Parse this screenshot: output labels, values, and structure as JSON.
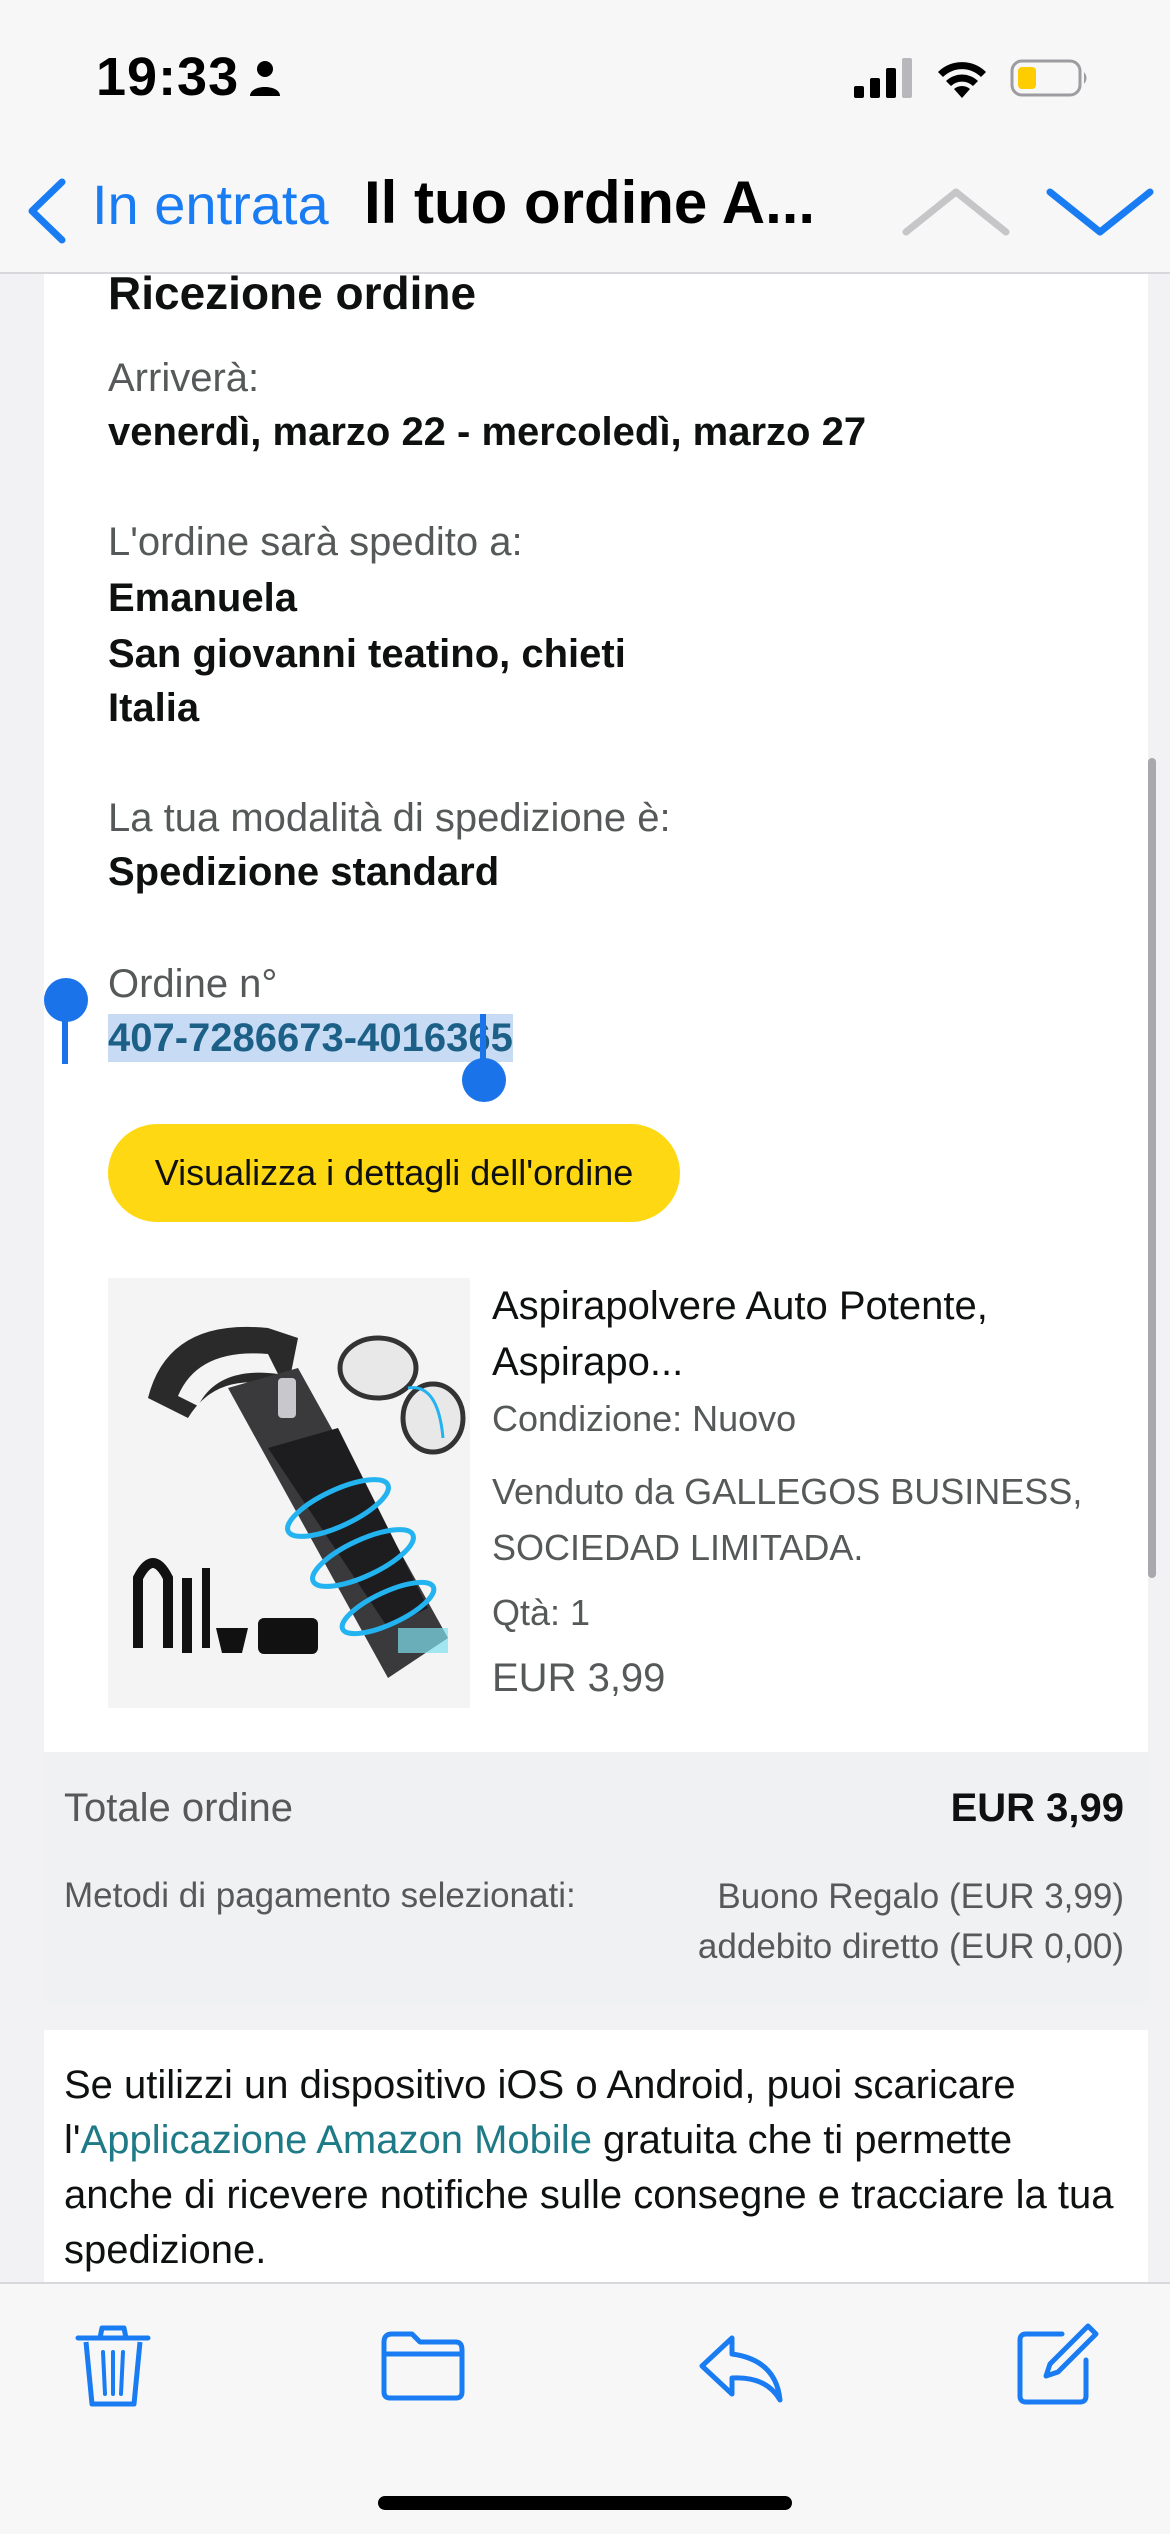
{
  "status_bar": {
    "time": "19:33",
    "person_icon": "person-icon",
    "signal_icon": "cellular-signal-icon",
    "wifi_icon": "wifi-icon",
    "battery_icon": "battery-low-icon",
    "battery_color": "#ffcc00"
  },
  "nav": {
    "back_label": "In entrata",
    "title": "Il tuo ordine A...",
    "accent": "#1a7cf2"
  },
  "email": {
    "section_title": "Ricezione ordine",
    "arrival_label": "Arriverà:",
    "arrival_value": "venerdì, marzo 22 - mercoledì, marzo 27",
    "ship_to_label": "L'ordine sarà spedito a:",
    "ship_to_name": "Emanuela",
    "ship_to_city": "San giovanni teatino, chieti",
    "ship_to_country": "Italia",
    "shipping_method_label": "La tua modalità di spedizione è:",
    "shipping_method_value": "Spedizione standard",
    "order_number_label": "Ordine n°",
    "order_number": "407-7286673-4016365",
    "details_button": "Visualizza i dettagli dell'ordine",
    "details_button_color": "#ffd814",
    "product": {
      "title": "Aspirapolvere Auto Potente, Aspirapo...",
      "condition": "Condizione: Nuovo",
      "seller": "Venduto da GALLEGOS BUSINESS, SOCIEDAD LIMITADA.",
      "quantity": "Qtà: 1",
      "price": "EUR 3,99"
    },
    "summary": {
      "total_label": "Totale ordine",
      "total_value": "EUR 3,99",
      "payment_label": "Metodi di pagamento selezionati:",
      "payment_line1": "Buono Regalo (EUR 3,99)",
      "payment_line2": "addebito diretto (EUR 0,00)"
    },
    "info": {
      "text_before": "Se utilizzi un dispositivo iOS o Android, puoi scaricare l'",
      "link": "Applicazione Amazon Mobile",
      "text_after": " gratuita che ti permette anche di ricevere notifiche sulle consegne e tracciare la tua spedizione."
    }
  },
  "toolbar": {
    "items": [
      "trash-icon",
      "folder-icon",
      "reply-icon",
      "compose-icon"
    ]
  }
}
